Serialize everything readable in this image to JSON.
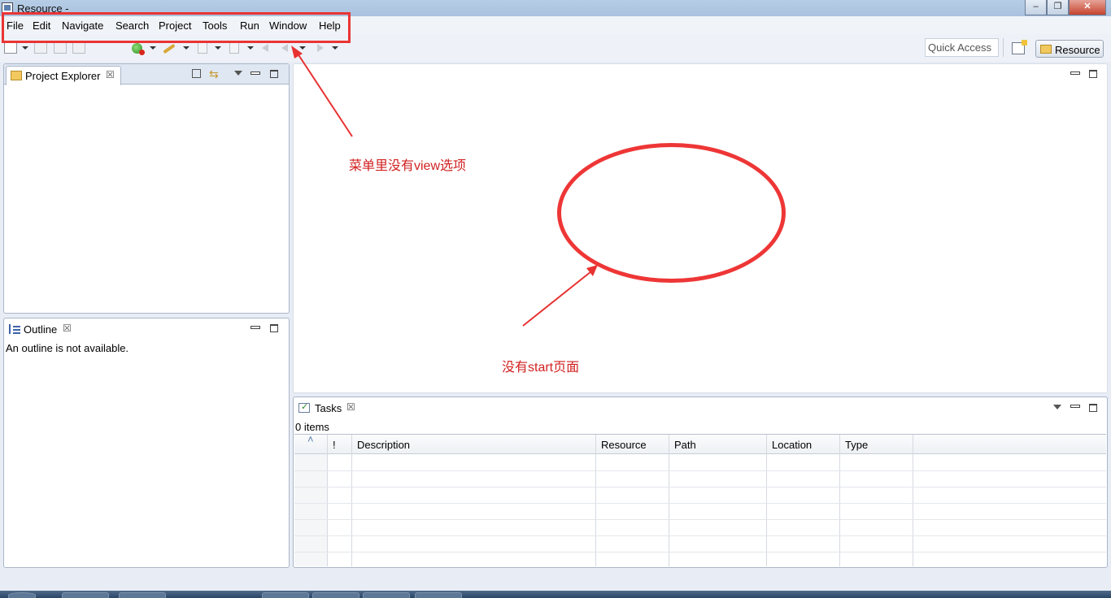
{
  "window": {
    "title": "Resource -",
    "minimize_icon": "minimize-icon",
    "restore_icon": "restore-icon",
    "close_icon": "close-icon"
  },
  "menu": [
    "File",
    "Edit",
    "Navigate",
    "Search",
    "Project",
    "Tools",
    "Run",
    "Window",
    "Help"
  ],
  "toolbar": {
    "quick_access": "Quick Access",
    "perspective_label": "Resource",
    "icons": [
      "new-icon",
      "save-icon",
      "save-all-icon",
      "print-icon",
      "run-icon",
      "external-tools-icon",
      "annotation-next-icon",
      "annotation-prev-icon",
      "last-edit-icon",
      "back-icon",
      "forward-icon",
      "open-perspective-icon"
    ]
  },
  "project_explorer": {
    "title": "Project Explorer"
  },
  "outline": {
    "title": "Outline",
    "message": "An outline is not available."
  },
  "tasks": {
    "title": "Tasks",
    "count": "0 items",
    "columns": [
      "",
      "!",
      "Description",
      "Resource",
      "Path",
      "Location",
      "Type"
    ],
    "rows": 7
  },
  "annotations": {
    "menu_note": "菜单里没有view选项",
    "start_note": "没有start页面",
    "color": "#e83232"
  },
  "colors": {
    "tab_strip": "#dfe7f2",
    "background": "#e8edf5",
    "annotation": "#e83232"
  }
}
